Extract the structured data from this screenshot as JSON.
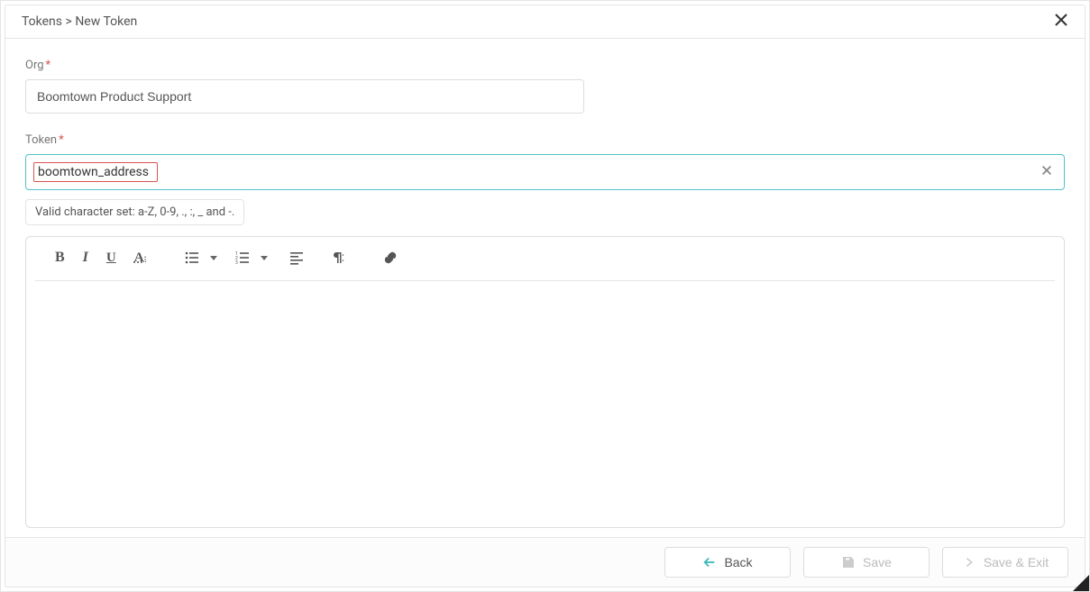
{
  "breadcrumb": {
    "parent": "Tokens",
    "separator": ">",
    "current": "New Token"
  },
  "fields": {
    "org": {
      "label": "Org",
      "value": "Boomtown Product Support"
    },
    "token": {
      "label": "Token",
      "value": "boomtown_address"
    }
  },
  "hint": "Valid character set: a-Z, 0-9, ., :, _ and -.",
  "footer": {
    "back": "Back",
    "save": "Save",
    "save_exit": "Save & Exit"
  }
}
